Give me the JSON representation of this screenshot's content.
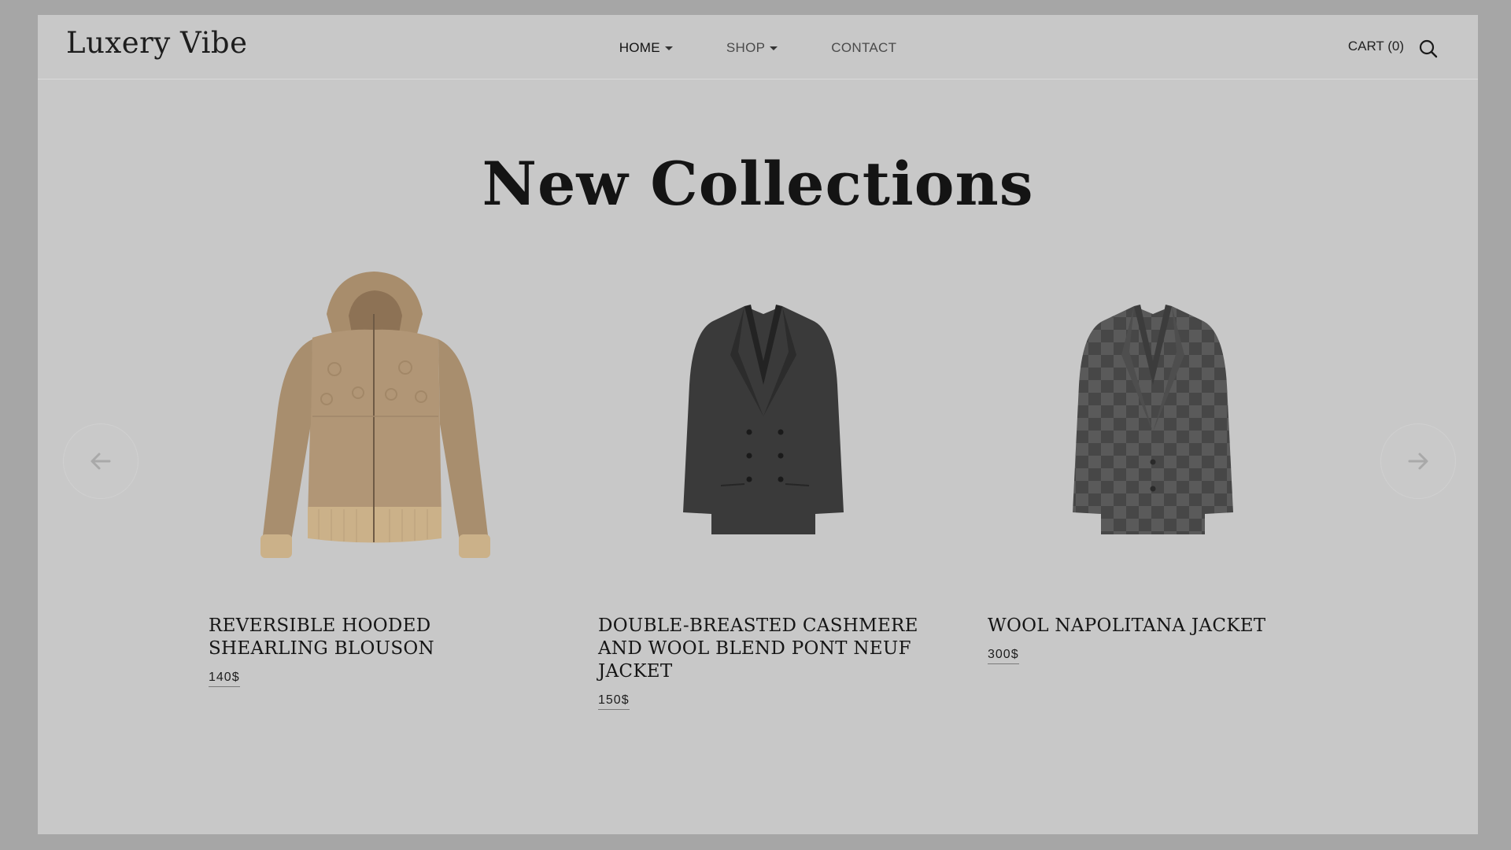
{
  "brand": {
    "logo": "Luxery Vibe"
  },
  "nav": [
    {
      "label": "HOME",
      "dropdown": true
    },
    {
      "label": "SHOP",
      "dropdown": true
    },
    {
      "label": "CONTACT",
      "dropdown": false
    }
  ],
  "header": {
    "cart_label": "CART (0)"
  },
  "page": {
    "title": "New Collections"
  },
  "products": [
    {
      "name": "REVERSIBLE HOODED SHEARLING BLOUSON",
      "price": "140$",
      "image": "beige-shearling-hoodie"
    },
    {
      "name": "DOUBLE-BREASTED CASHMERE AND WOOL BLEND PONT NEUF JACKET",
      "price": "150$",
      "image": "charcoal-double-breasted-blazer"
    },
    {
      "name": "WOOL NAPOLITANA JACKET",
      "price": "300$",
      "image": "grey-checkered-blazer"
    }
  ],
  "colors": {
    "page_background": "#c8c8c8",
    "outer_background": "#a6a6a6",
    "text": "#141414"
  }
}
